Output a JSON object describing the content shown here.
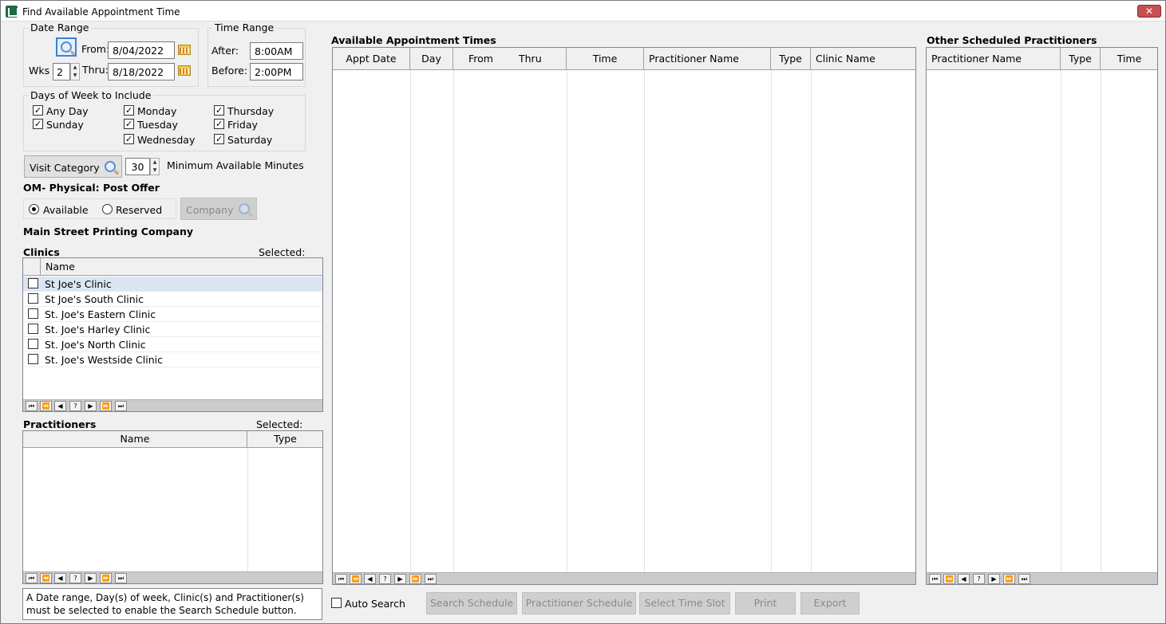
{
  "window": {
    "title": "Find Available Appointment Time",
    "close": "✕"
  },
  "date_range": {
    "legend": "Date Range",
    "from_label": "From:",
    "from_value": "8/04/2022",
    "thru_label": "Thru:",
    "thru_value": "8/18/2022",
    "wks_label": "Wks",
    "wks_value": "2"
  },
  "time_range": {
    "legend": "Time Range",
    "after_label": "After:",
    "after_value": "8:00AM",
    "before_label": "Before:",
    "before_value": "2:00PM"
  },
  "days": {
    "legend": "Days of Week to Include",
    "items": [
      {
        "label": "Any Day",
        "checked": true
      },
      {
        "label": "Sunday",
        "checked": true
      },
      {
        "label": "Monday",
        "checked": true
      },
      {
        "label": "Tuesday",
        "checked": true
      },
      {
        "label": "Wednesday",
        "checked": true
      },
      {
        "label": "Thursday",
        "checked": true
      },
      {
        "label": "Friday",
        "checked": true
      },
      {
        "label": "Saturday",
        "checked": true
      }
    ]
  },
  "visit": {
    "button": "Visit Category",
    "minutes_value": "30",
    "minutes_label": "Minimum Available Minutes",
    "category_name": "OM- Physical: Post Offer"
  },
  "availability": {
    "available": "Available",
    "reserved": "Reserved",
    "selected": "available",
    "company_button": "Company",
    "company_name": "Main Street Printing Company"
  },
  "clinics": {
    "title": "Clinics",
    "selected_label": "Selected:",
    "header_name": "Name",
    "rows": [
      "St Joe's Clinic",
      "St Joe's South Clinic",
      "St. Joe's Eastern Clinic",
      "St. Joe's Harley Clinic",
      "St. Joe's North Clinic",
      "St. Joe's Westside Clinic"
    ]
  },
  "practitioners": {
    "title": "Practitioners",
    "selected_label": "Selected:",
    "headers": [
      "Name",
      "Type"
    ]
  },
  "nav": [
    "⏮",
    "⏪",
    "◀",
    "?",
    "▶",
    "⏩",
    "⏭"
  ],
  "message": "A Date range, Day(s) of week, Clinic(s) and Practitioner(s) must be selected to enable the Search Schedule button.",
  "appointments": {
    "title": "Available Appointment Times",
    "headers": [
      "Appt Date",
      "Day",
      "From",
      "Thru",
      "Time",
      "Practitioner Name",
      "Type",
      "Clinic Name"
    ]
  },
  "others": {
    "title": "Other Scheduled Practitioners",
    "headers": [
      "Practitioner Name",
      "Type",
      "Time"
    ]
  },
  "bottom": {
    "auto_search": "Auto Search",
    "buttons": [
      "Search Schedule",
      "Practitioner Schedule",
      "Select Time Slot",
      "Print",
      "Export"
    ]
  }
}
